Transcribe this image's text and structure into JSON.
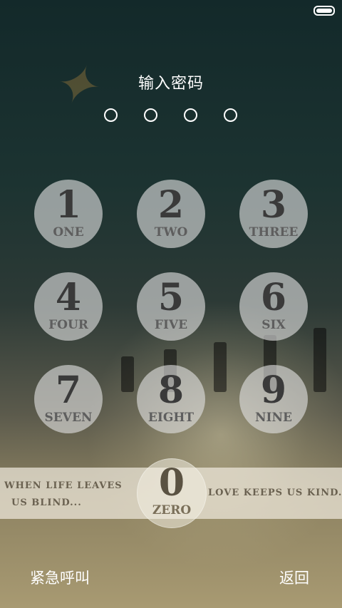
{
  "status_bar": {
    "battery_icon": "battery-icon"
  },
  "lock": {
    "title": "输入密码",
    "pin_length": 4,
    "entered": 0
  },
  "keypad": {
    "keys": [
      {
        "num": "1",
        "word": "ONE"
      },
      {
        "num": "2",
        "word": "TWO"
      },
      {
        "num": "3",
        "word": "THREE"
      },
      {
        "num": "4",
        "word": "FOUR"
      },
      {
        "num": "5",
        "word": "FIVE"
      },
      {
        "num": "6",
        "word": "SIX"
      },
      {
        "num": "7",
        "word": "SEVEN"
      },
      {
        "num": "8",
        "word": "EIGHT"
      },
      {
        "num": "9",
        "word": "NINE"
      },
      {
        "num": "0",
        "word": "ZERO"
      }
    ]
  },
  "quote": {
    "line1": "WHEN LIFE LEAVES",
    "line2": "US BLIND...",
    "line3": "LOVE KEEPS US KIND."
  },
  "bottom": {
    "emergency_label": "紧急呼叫",
    "back_label": "返回"
  },
  "colors": {
    "key_fill": "#e1e1e1",
    "text_white": "#ffffff",
    "band": "#eee9dc"
  }
}
